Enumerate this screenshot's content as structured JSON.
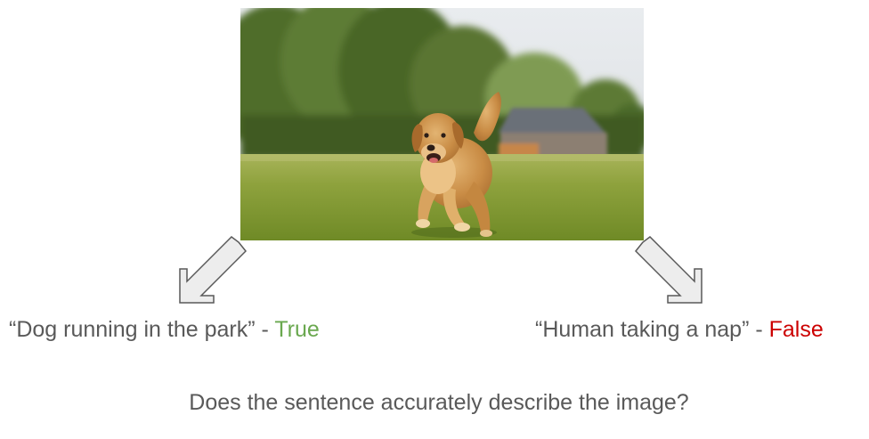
{
  "image": {
    "subject": "dog-running-in-park"
  },
  "captions": [
    {
      "text": "“Dog running in the park”",
      "separator": " - ",
      "verdict": "True",
      "verdict_color": "#6aa84f"
    },
    {
      "text": "“Human taking a nap”",
      "separator": " - ",
      "verdict": "False",
      "verdict_color": "#cc0000"
    }
  ],
  "question": "Does the sentence accurately describe the image?",
  "colors": {
    "text": "#595959",
    "arrow_fill": "#ededed",
    "arrow_stroke": "#595959"
  }
}
